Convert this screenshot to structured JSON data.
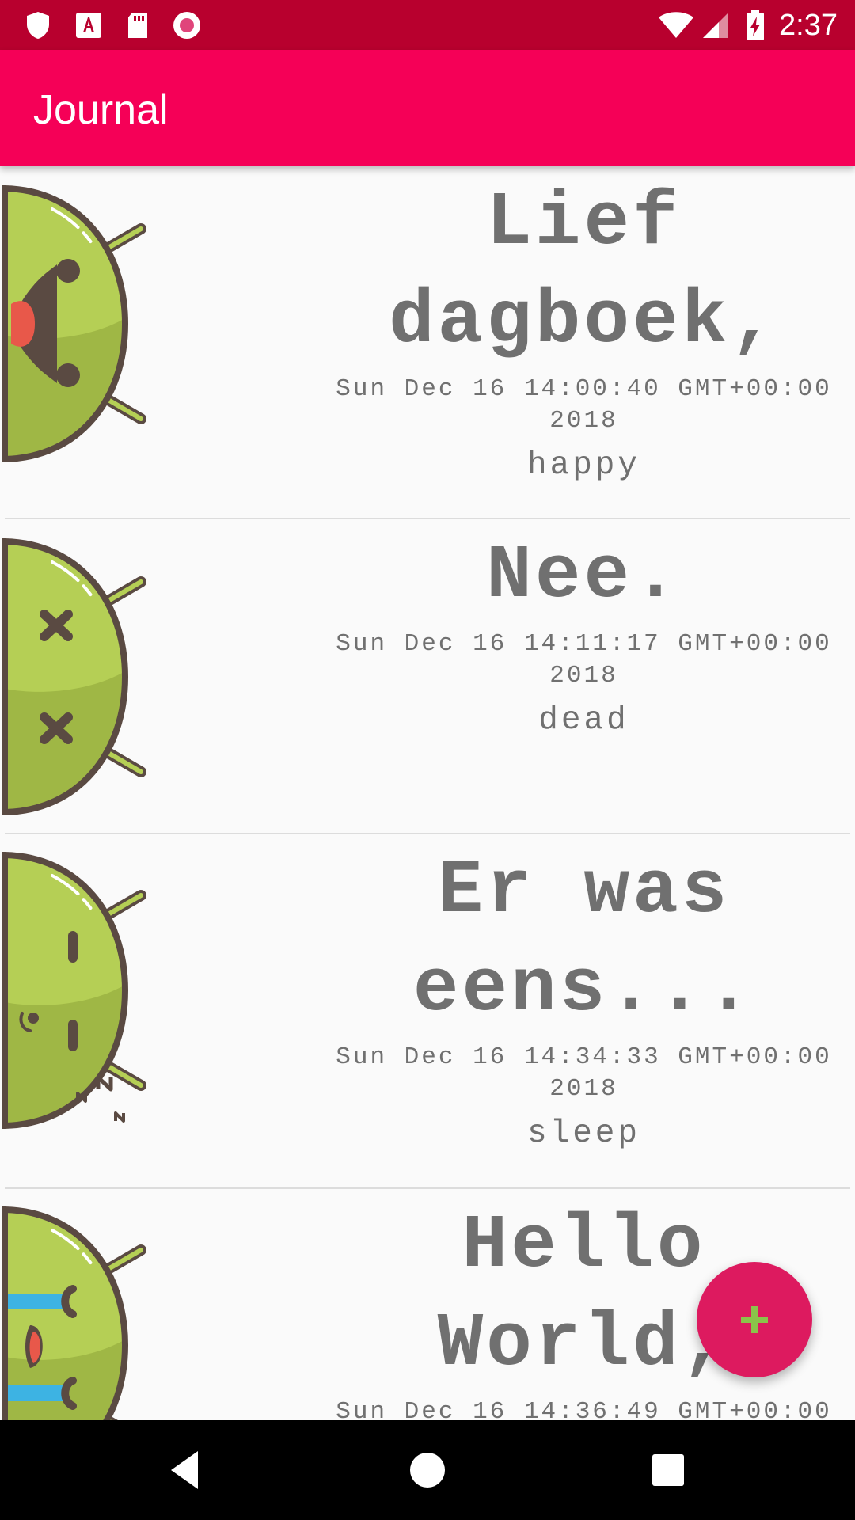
{
  "status_bar": {
    "time": "2:37",
    "icons": [
      "shield-icon",
      "font-download-icon",
      "sd-card-icon",
      "record-icon",
      "wifi-icon",
      "signal-icon",
      "battery-charging-icon"
    ]
  },
  "app_bar": {
    "title": "Journal"
  },
  "entries": [
    {
      "title": "Lief dagboek,",
      "date": "Sun Dec 16 14:00:40 GMT+00:00 2018",
      "mood": "happy",
      "avatar_icon": "happy-android-icon"
    },
    {
      "title": "Nee.",
      "date": "Sun Dec 16 14:11:17 GMT+00:00 2018",
      "mood": "dead",
      "avatar_icon": "dead-android-icon"
    },
    {
      "title": "Er was eens...",
      "date": "Sun Dec 16 14:34:33 GMT+00:00 2018",
      "mood": "sleep",
      "avatar_icon": "sleep-android-icon"
    },
    {
      "title": "Hello World,",
      "date": "Sun Dec 16 14:36:49 GMT+00:00",
      "avatar_icon": "crying-android-icon"
    }
  ],
  "fab": {
    "icon": "plus-icon"
  },
  "nav_bar": {
    "icons": [
      "back-icon",
      "home-icon",
      "recents-icon"
    ]
  },
  "colors": {
    "status_bar": "#b8002e",
    "app_bar": "#f50057",
    "fab": "#dd1a5f",
    "fab_icon": "#8bc34a",
    "text": "#707070",
    "android_green": "#b5cf55"
  }
}
